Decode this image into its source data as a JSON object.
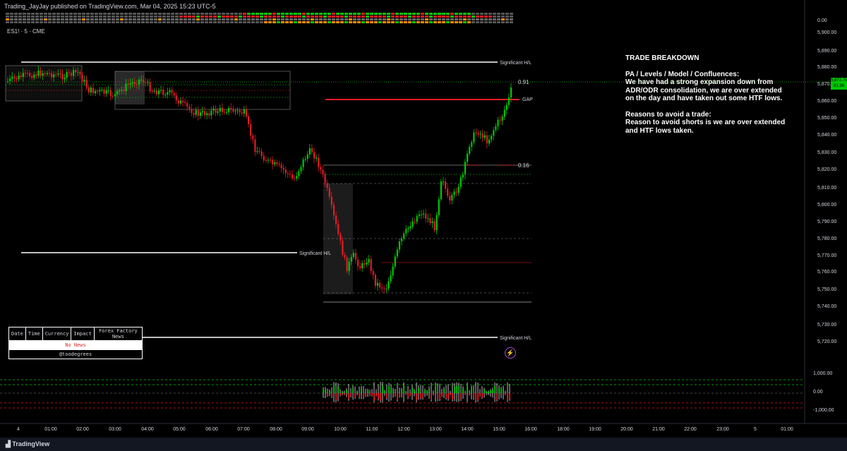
{
  "header": {
    "publish_line": "Trading_JayJay published on TradingView.com, Mar 04, 2025 15:23 UTC-5",
    "symbol": "ES1! · 5 · CME"
  },
  "price_axis": {
    "labels": [
      "0.00",
      "5,900.00",
      "5,890.00",
      "5,880.00",
      "5,870.00",
      "5,860.00",
      "5,850.00",
      "5,840.00",
      "5,830.00",
      "5,820.00",
      "5,810.00",
      "5,800.00",
      "5,790.00",
      "5,780.00",
      "5,770.00",
      "5,760.00",
      "5,750.00",
      "5,740.00",
      "5,730.00",
      "5,720.00"
    ],
    "volume_labels": [
      "1,000.00",
      "0.00",
      "-1,000.00"
    ],
    "current_price": "5,872.75",
    "countdown": "01:36"
  },
  "time_axis": {
    "labels": [
      "4",
      "01:00",
      "02:00",
      "03:00",
      "04:00",
      "05:00",
      "06:00",
      "07:00",
      "08:00",
      "09:00",
      "10:00",
      "11:00",
      "12:00",
      "13:00",
      "14:00",
      "15:00",
      "16:00",
      "18:00",
      "19:00",
      "20:00",
      "21:00",
      "22:00",
      "23:00",
      "5",
      "01:00"
    ]
  },
  "chart_labels": {
    "sig_top": "Significant H/L",
    "sig_mid": "Significant H/L",
    "sig_bottom": "Significant H/L",
    "fib_top": "0.91",
    "fib_low": "0.16",
    "gap": "GAP"
  },
  "trade_breakdown": {
    "title": "TRADE BREAKDOWN",
    "section1_heading": "PA / Levels / Model / Confluences:",
    "section1_body": "We have had a strong expansion down from ADR/ODR consolidation, we are over extended on the day and have taken out some HTF lows.",
    "section2_heading": "Reasons to avoid a trade:",
    "section2_body": "Reason to avoid shorts is we are over extended and HTF lows taken."
  },
  "news_table": {
    "headers": [
      "Date",
      "Time",
      "Currency",
      "Impact",
      "Forex Factory News"
    ],
    "empty_text": "No News",
    "handle": "@toodegrees"
  },
  "footer": {
    "brand": "TradingView"
  },
  "colors": {
    "bull": "#00c805",
    "bear": "#e31c25",
    "accent_purple": "#b04bd6"
  }
}
